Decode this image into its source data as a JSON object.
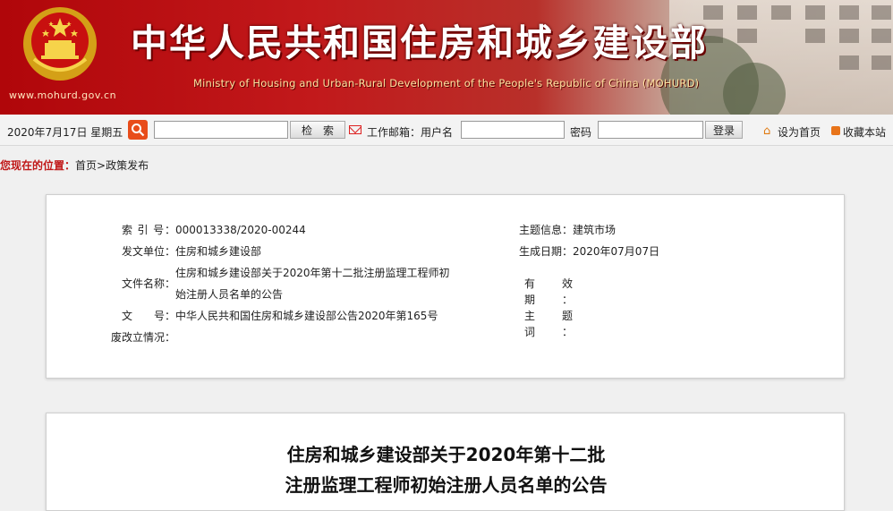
{
  "header": {
    "site_title": "中华人民共和国住房和城乡建设部",
    "site_subtitle": "Ministry of Housing and Urban-Rural Development of the People's Republic of China (MOHURD)",
    "domain": "www.mohurd.gov.cn"
  },
  "toolbar": {
    "date": "2020年7月17日 星期五",
    "search_value": "",
    "search_button": "检　索",
    "email_label": "工作邮箱：用户名",
    "username_value": "",
    "password_label": "密码",
    "password_value": "",
    "login_button": "登录",
    "set_home": "设为首页",
    "bookmark": "收藏本站"
  },
  "breadcrumb": {
    "label": "您现在的位置：",
    "path": "首页>政策发布"
  },
  "info": {
    "index_label": "索 引 号：",
    "index_value": "000013338/2020-00244",
    "topic_label": "主题信息：",
    "topic_value": "建筑市场",
    "issuer_label": "发文单位：",
    "issuer_value": "住房和城乡建设部",
    "date_label": "生成日期：",
    "date_value": "2020年07月07日",
    "docname_label": "文件名称：",
    "docname_line1": "住房和城乡建设部关于2020年第十二批注册监理工程师初",
    "docname_line2": "始注册人员名单的公告",
    "valid_label": "有 效 期：",
    "valid_value": "",
    "docno_label": "文　　号：",
    "docno_value": "中华人民共和国住房和城乡建设部公告2020年第165号",
    "keywords_label": "主 题 词：",
    "keywords_value": "",
    "status_label": "废改立情况：",
    "status_value": ""
  },
  "article": {
    "title_line1": "住房和城乡建设部关于2020年第十二批",
    "title_line2": "注册监理工程师初始注册人员名单的公告"
  },
  "colors": {
    "banner_red": "#b0060a",
    "crumb_red": "#c01818",
    "search_orange": "#e84c1a"
  }
}
